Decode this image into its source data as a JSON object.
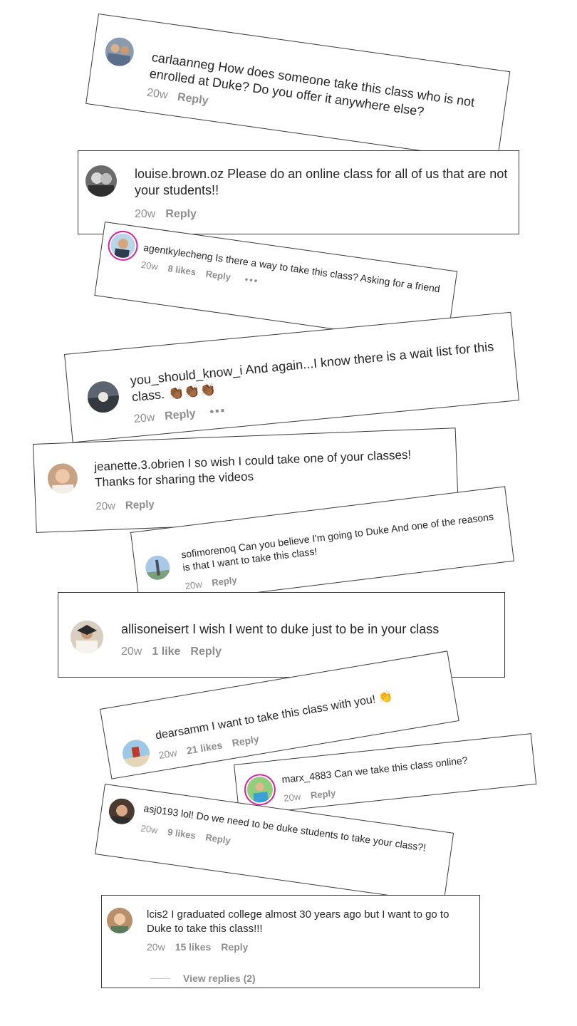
{
  "comments": [
    {
      "username": "carlaanneg",
      "text": "How does someone take this class who is not enrolled at Duke? Do you offer it anywhere else?",
      "time": "20w",
      "likes": "",
      "reply": "Reply",
      "more": ""
    },
    {
      "username": "louise.brown.oz",
      "text": "Please do an online class for all of us that are not your students!!",
      "time": "20w",
      "likes": "",
      "reply": "Reply",
      "more": ""
    },
    {
      "username": "agentkylecheng",
      "text": "Is there a way to take this class? Asking for a friend",
      "time": "20w",
      "likes": "8 likes",
      "reply": "Reply",
      "more": "•••"
    },
    {
      "username": "you_should_know_i",
      "text": "And again...I know there is a wait list for this class. 👏🏾👏🏾👏🏾",
      "time": "20w",
      "likes": "",
      "reply": "Reply",
      "more": "•••"
    },
    {
      "username": "jeanette.3.obrien",
      "text": "I so wish I could take one of your classes! Thanks for sharing the videos",
      "time": "20w",
      "likes": "",
      "reply": "Reply",
      "more": ""
    },
    {
      "username": "sofimorenoq",
      "text": "Can you believe I'm going to Duke And one of the reasons is that I want to take this class!",
      "time": "20w",
      "likes": "",
      "reply": "Reply",
      "more": ""
    },
    {
      "username": "allisoneisert",
      "text": "I wish I went to duke just to be in your class",
      "time": "20w",
      "likes": "1 like",
      "reply": "Reply",
      "more": ""
    },
    {
      "username": "dearsamm",
      "text": "I want to take this class with you! 👏",
      "time": "20w",
      "likes": "21 likes",
      "reply": "Reply",
      "more": ""
    },
    {
      "username": "marx_4883",
      "text": "Can we take this class online?",
      "time": "20w",
      "likes": "",
      "reply": "Reply",
      "more": ""
    },
    {
      "username": "asj0193",
      "text": "lol! Do we need to be duke students to take your class?!",
      "time": "20w",
      "likes": "9 likes",
      "reply": "Reply",
      "more": ""
    },
    {
      "username": "lcis2",
      "text": "I graduated college almost 30 years ago but I want to go to Duke to take this class!!!",
      "time": "20w",
      "likes": "15 likes",
      "reply": "Reply",
      "more": ""
    }
  ],
  "view_replies": "View replies (2)",
  "colors": {
    "meta_gray": "#8e8e8e",
    "text": "#262626",
    "border": "#3a3a3a",
    "story_ring": "#d6249f"
  }
}
